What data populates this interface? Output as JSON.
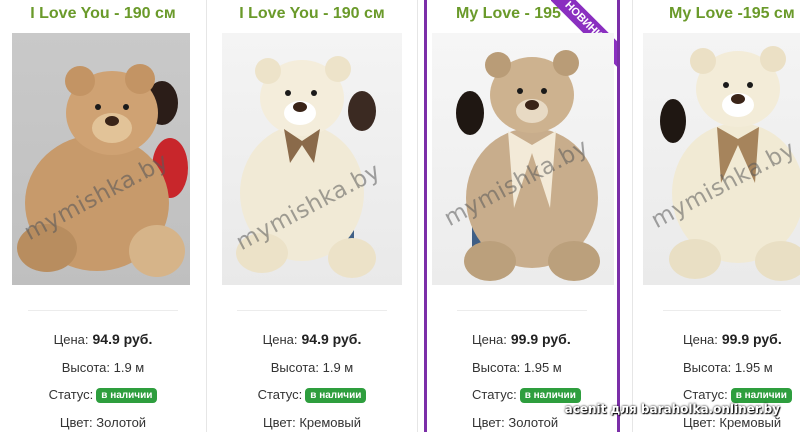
{
  "credit": "acenit для baraholka.onliner.by",
  "cards": [
    {
      "title": "I Love You - 190 см",
      "watermark": "mymishka.by",
      "price_label": "Цена:",
      "price": "94.9 руб.",
      "height_label": "Высота:",
      "height": "1.9 м",
      "status_label": "Статус:",
      "status": "в наличии",
      "color_label": "Цвет:",
      "color": "Золотой"
    },
    {
      "title": "I Love You - 190 см",
      "watermark": "mymishka.by",
      "price_label": "Цена:",
      "price": "94.9 руб.",
      "height_label": "Высота:",
      "height": "1.9 м",
      "status_label": "Статус:",
      "status": "в наличии",
      "color_label": "Цвет:",
      "color": "Кремовый"
    },
    {
      "title": "My Love - 195",
      "ribbon": "НОВИНКА",
      "watermark": "mymishka.by",
      "price_label": "Цена:",
      "price": "99.9 руб.",
      "height_label": "Высота:",
      "height": "1.95 м",
      "status_label": "Статус:",
      "status": "в наличии",
      "color_label": "Цвет:",
      "color": "Золотой"
    },
    {
      "title": "My Love -195 см",
      "watermark": "mymishka.by",
      "price_label": "Цена:",
      "price": "99.9 руб.",
      "height_label": "Высота:",
      "height": "1.95 м",
      "status_label": "Статус:",
      "status": "в наличии",
      "color_label": "Цвет:",
      "color": "Кремовый"
    }
  ]
}
